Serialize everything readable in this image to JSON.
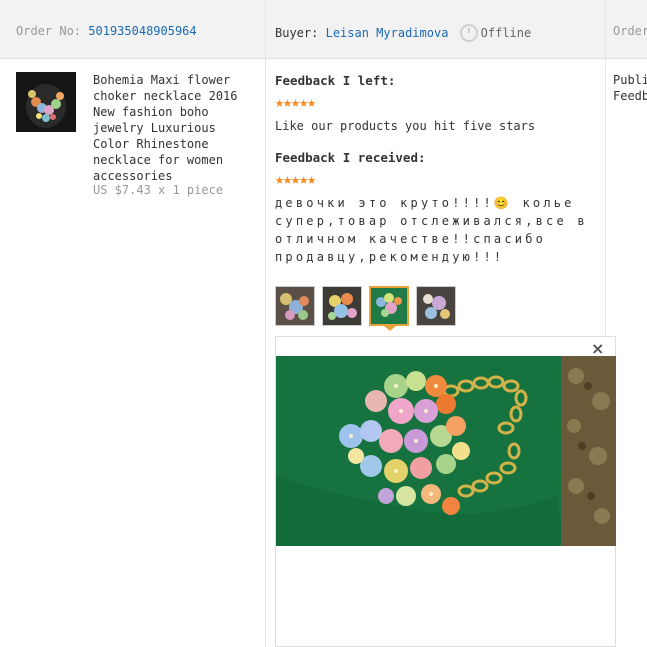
{
  "header": {
    "order_label": "Order No:",
    "order_number": "501935048905964",
    "buyer_label": "Buyer:",
    "buyer_name": "Leisan Myradimova",
    "status": "Offline",
    "right_cut": "Order"
  },
  "product": {
    "title": "Bohemia Maxi flower choker necklace 2016 New fashion boho jewelry Luxurious Color Rhinestone necklace for women accessories",
    "price": "US $7.43 x 1 piece"
  },
  "feedback": {
    "left_label": "Feedback I left:",
    "left_stars": "★★★★★",
    "left_text": "Like our products you hit five stars",
    "received_label": "Feedback I received:",
    "received_stars": "★★★★★",
    "received_text": "девочки это круто!!!!😊 колье супер,товар отслеживался,все в отличном качестве!!спасибо продавцу,рекомендую!!!",
    "rating": 5
  },
  "viewer": {
    "close": "×"
  },
  "right_column": {
    "line1": "Publi",
    "line2": "Feedb"
  },
  "colors": {
    "link": "#1a6ab4",
    "star": "#f6891f",
    "header_bg": "#f2f2f2",
    "selected": "#e8a23a"
  }
}
